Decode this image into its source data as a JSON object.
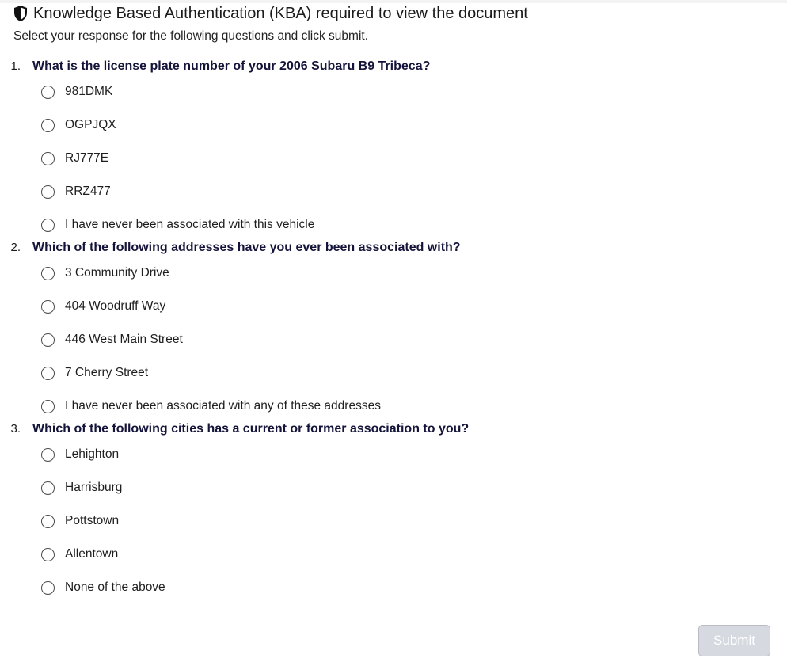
{
  "header": {
    "title": "Knowledge Based Authentication (KBA) required to view the document",
    "instructions": "Select your response for the following questions and click submit."
  },
  "questions": [
    {
      "number": "1.",
      "text": "What is the license plate number of your 2006 Subaru B9 Tribeca?",
      "options": [
        "981DMK",
        "OGPJQX",
        "RJ777E",
        "RRZ477",
        "I have never been associated with this vehicle"
      ]
    },
    {
      "number": "2.",
      "text": "Which of the following addresses have you ever been associated with?",
      "options": [
        "3 Community Drive",
        "404 Woodruff Way",
        "446 West Main Street",
        "7 Cherry Street",
        "I have never been associated with any of these addresses"
      ]
    },
    {
      "number": "3.",
      "text": "Which of the following cities has a current or former association to you?",
      "options": [
        "Lehighton",
        "Harrisburg",
        "Pottstown",
        "Allentown",
        "None of the above"
      ]
    }
  ],
  "submit": {
    "label": "Submit",
    "state": "disabled"
  },
  "icons": {
    "header": "shield-icon"
  },
  "colors": {
    "question_text": "#14143a",
    "submit_bg": "#d6d9e0",
    "submit_text": "#ffffff"
  }
}
